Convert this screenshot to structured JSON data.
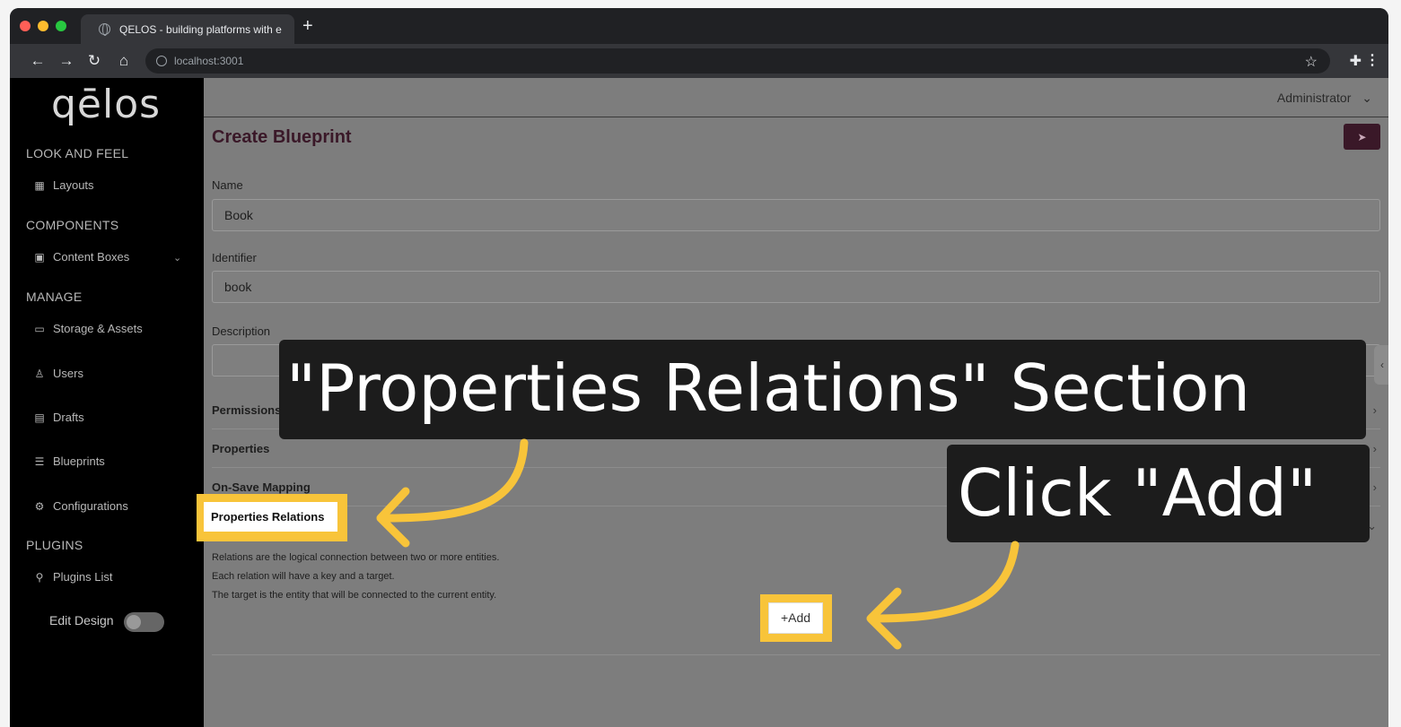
{
  "browser": {
    "tab_title": "QELOS - building platforms with e",
    "new_tab": "+",
    "url": "localhost:3001"
  },
  "sidebar": {
    "logo": "qēlos",
    "sections": {
      "look_and_feel": "LOOK AND FEEL",
      "components": "COMPONENTS",
      "manage": "MANAGE",
      "plugins": "PLUGINS"
    },
    "items": {
      "layouts": "Layouts",
      "content_boxes": "Content Boxes",
      "storage": "Storage & Assets",
      "users": "Users",
      "drafts": "Drafts",
      "blueprints": "Blueprints",
      "configurations": "Configurations",
      "plugins_list": "Plugins List"
    },
    "edit_design": "Edit Design"
  },
  "header": {
    "user_menu": "Administrator"
  },
  "form": {
    "title": "Create Blueprint",
    "name_label": "Name",
    "name_value": "Book",
    "identifier_label": "Identifier",
    "identifier_value": "book",
    "description_label": "Description",
    "sections": {
      "permissions": "Permissions and Roles",
      "properties": "Properties",
      "on_save": "On-Save Mapping",
      "relations": "Properties Relations"
    },
    "relations_description": [
      "Relations are the logical connection between two or more entities.",
      "Each relation will have a key and a target.",
      "The target is the entity that will be connected to the current entity."
    ],
    "add_button": "+Add"
  },
  "annotations": {
    "banner_1": "\"Properties Relations\" Section",
    "banner_2": "Click \"Add\"",
    "highlight_color": "#f8c43a"
  }
}
